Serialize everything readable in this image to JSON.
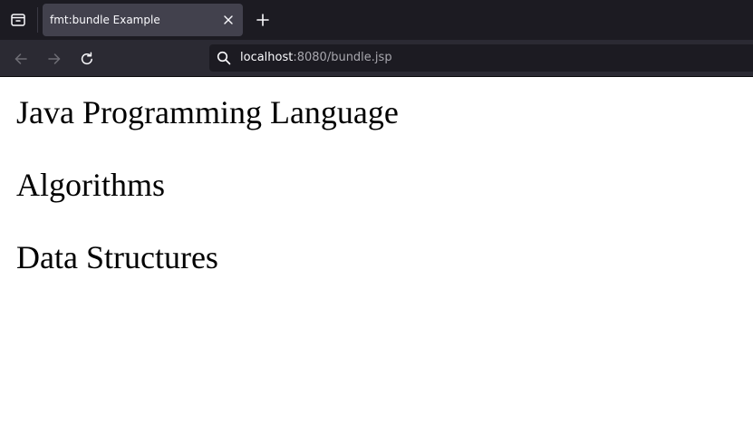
{
  "browser": {
    "tab": {
      "title": "fmt:bundle Example"
    },
    "urlbar": {
      "host": "localhost",
      "path": ":8080/bundle.jsp"
    },
    "icons": {
      "tab_overview": "tab-overview-icon",
      "close": "close-icon",
      "new_tab": "plus-icon",
      "back": "back-arrow-icon",
      "forward": "forward-arrow-icon",
      "reload": "reload-icon",
      "search": "search-icon"
    },
    "colors": {
      "tabstrip_bg": "#1c1b22",
      "active_tab_bg": "#42414d",
      "navbar_bg": "#2b2a33",
      "url_host": "#fbfbfe",
      "url_path": "#a8a7ae"
    }
  },
  "page": {
    "headings": [
      "Java Programming Language",
      "Algorithms",
      "Data Structures"
    ]
  }
}
